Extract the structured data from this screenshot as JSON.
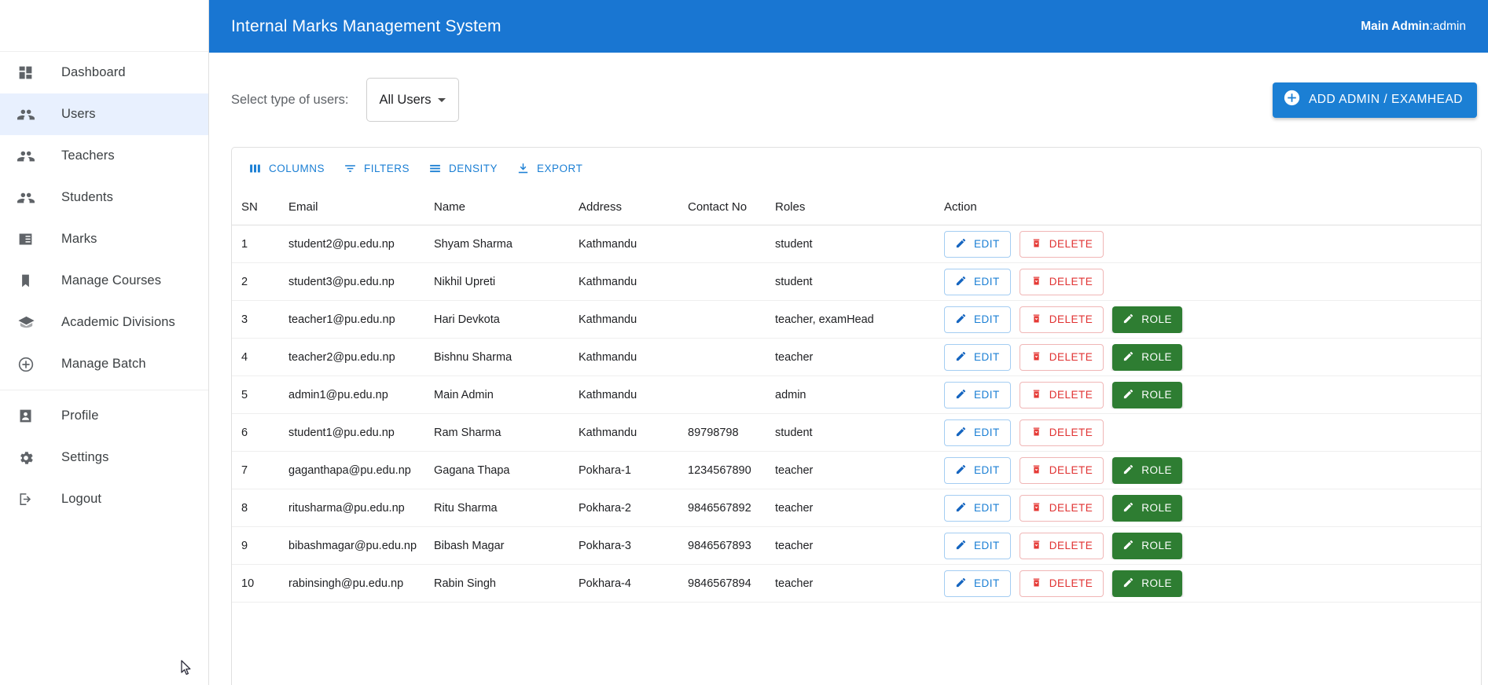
{
  "header": {
    "title": "Internal Marks Management System",
    "user_name": "Main Admin",
    "user_role": ":admin",
    "bg_color": "#1976d2"
  },
  "sidebar": {
    "items": [
      {
        "label": "Dashboard",
        "icon": "dashboard-icon",
        "active": false
      },
      {
        "label": "Users",
        "icon": "people-icon",
        "active": true
      },
      {
        "label": "Teachers",
        "icon": "people-icon",
        "active": false
      },
      {
        "label": "Students",
        "icon": "people-icon",
        "active": false
      },
      {
        "label": "Marks",
        "icon": "article-icon",
        "active": false
      },
      {
        "label": "Manage Courses",
        "icon": "bookmark-icon",
        "active": false
      },
      {
        "label": "Academic Divisions",
        "icon": "school-icon",
        "active": false
      },
      {
        "label": "Manage Batch",
        "icon": "plus-circle-icon",
        "active": false
      }
    ],
    "bottom_items": [
      {
        "label": "Profile",
        "icon": "person-box-icon"
      },
      {
        "label": "Settings",
        "icon": "gear-icon"
      },
      {
        "label": "Logout",
        "icon": "logout-icon"
      }
    ]
  },
  "controls": {
    "select_label": "Select type of users:",
    "select_value": "All Users",
    "add_button_label": "ADD ADMIN / EXAMHEAD",
    "add_button_color": "#1b7fd4"
  },
  "grid_toolbar": [
    {
      "label": "COLUMNS",
      "icon": "columns-icon"
    },
    {
      "label": "FILTERS",
      "icon": "filter-icon"
    },
    {
      "label": "DENSITY",
      "icon": "density-icon"
    },
    {
      "label": "EXPORT",
      "icon": "download-icon"
    }
  ],
  "table": {
    "columns": [
      "SN",
      "Email",
      "Name",
      "Address",
      "Contact No",
      "Roles",
      "Action"
    ],
    "action_labels": {
      "edit": "EDIT",
      "delete": "DELETE",
      "role": "ROLE"
    },
    "rows": [
      {
        "sn": "1",
        "email": "student2@pu.edu.np",
        "name": "Shyam Sharma",
        "address": "Kathmandu",
        "contact": "",
        "roles": "student",
        "has_role": false
      },
      {
        "sn": "2",
        "email": "student3@pu.edu.np",
        "name": "Nikhil Upreti",
        "address": "Kathmandu",
        "contact": "",
        "roles": "student",
        "has_role": false
      },
      {
        "sn": "3",
        "email": "teacher1@pu.edu.np",
        "name": "Hari Devkota",
        "address": "Kathmandu",
        "contact": "",
        "roles": "teacher, examHead",
        "has_role": true
      },
      {
        "sn": "4",
        "email": "teacher2@pu.edu.np",
        "name": "Bishnu Sharma",
        "address": "Kathmandu",
        "contact": "",
        "roles": "teacher",
        "has_role": true
      },
      {
        "sn": "5",
        "email": "admin1@pu.edu.np",
        "name": "Main Admin",
        "address": "Kathmandu",
        "contact": "",
        "roles": "admin",
        "has_role": true
      },
      {
        "sn": "6",
        "email": "student1@pu.edu.np",
        "name": "Ram Sharma",
        "address": "Kathmandu",
        "contact": "89798798",
        "roles": "student",
        "has_role": false
      },
      {
        "sn": "7",
        "email": "gaganthapa@pu.edu.np",
        "name": "Gagana Thapa",
        "address": "Pokhara-1",
        "contact": "1234567890",
        "roles": "teacher",
        "has_role": true
      },
      {
        "sn": "8",
        "email": "ritusharma@pu.edu.np",
        "name": "Ritu Sharma",
        "address": "Pokhara-2",
        "contact": "9846567892",
        "roles": "teacher",
        "has_role": true
      },
      {
        "sn": "9",
        "email": "bibashmagar@pu.edu.np",
        "name": "Bibash Magar",
        "address": "Pokhara-3",
        "contact": "9846567893",
        "roles": "teacher",
        "has_role": true
      },
      {
        "sn": "10",
        "email": "rabinsingh@pu.edu.np",
        "name": "Rabin Singh",
        "address": "Pokhara-4",
        "contact": "9846567894",
        "roles": "teacher",
        "has_role": true
      }
    ]
  }
}
